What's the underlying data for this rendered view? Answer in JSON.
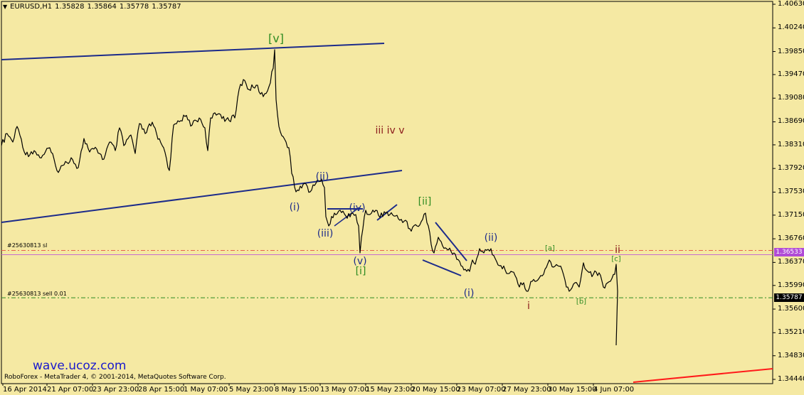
{
  "header": {
    "symbol": "EURUSD,H1",
    "open": "1.35828",
    "high": "1.35864",
    "low": "1.35778",
    "close": "1.35787"
  },
  "y_axis": {
    "ticks": [
      "1.40630",
      "1.40240",
      "1.39850",
      "1.39470",
      "1.39080",
      "1.38690",
      "1.38310",
      "1.37920",
      "1.37530",
      "1.37150",
      "1.36760",
      "1.36370",
      "1.35990",
      "1.35600",
      "1.35210",
      "1.34830",
      "1.34440"
    ],
    "price_tags": {
      "sl": "1.36533",
      "current": "1.35787"
    }
  },
  "x_axis": {
    "ticks": [
      "16 Apr 2014",
      "21 Apr 07:00",
      "23 Apr 23:00",
      "28 Apr 15:00",
      "1 May 07:00",
      "5 May 23:00",
      "8 May 15:00",
      "13 May 07:00",
      "15 May 23:00",
      "20 May 15:00",
      "23 May 07:00",
      "27 May 23:00",
      "30 May 15:00",
      "4 Jun 07:00"
    ]
  },
  "orders": {
    "sl_label": "#25630813 sl",
    "sell_label": "#25630813 sell 0.01"
  },
  "wave_labels": [
    {
      "text": "[v]",
      "color": "#2e8b22",
      "size": 16
    },
    {
      "text": "iii  iv v",
      "color": "#8b1a1a",
      "size": 14
    },
    {
      "text": "(ii)",
      "color": "#1c2b8a",
      "size": 14
    },
    {
      "text": "(i)",
      "color": "#1c2b8a",
      "size": 14
    },
    {
      "text": "(iii)",
      "color": "#1c2b8a",
      "size": 14
    },
    {
      "text": "(iv)",
      "color": "#1c2b8a",
      "size": 14
    },
    {
      "text": "(v)",
      "color": "#1c2b8a",
      "size": 14
    },
    {
      "text": "[i]",
      "color": "#2e8b22",
      "size": 14
    },
    {
      "text": "[ii]",
      "color": "#2e8b22",
      "size": 14
    },
    {
      "text": "(ii)",
      "color": "#1c2b8a",
      "size": 14
    },
    {
      "text": "(i)",
      "color": "#1c2b8a",
      "size": 14
    },
    {
      "text": "[a]",
      "color": "#2e8b22",
      "size": 10
    },
    {
      "text": "[b]",
      "color": "#2e8b22",
      "size": 10
    },
    {
      "text": "[c]",
      "color": "#2e8b22",
      "size": 10
    },
    {
      "text": "i",
      "color": "#8b1a1a",
      "size": 14
    },
    {
      "text": "ii",
      "color": "#8b1a1a",
      "size": 14
    }
  ],
  "watermark": "wave.ucoz.com",
  "footer": "RoboForex - MetaTrader 4, © 2001-2014, MetaQuotes Software Corp.",
  "colors": {
    "background": "#f5e9a3",
    "price_line": "#000000",
    "trend_line": "#1c2b8a",
    "stop_line": "#e8604a",
    "sell_line": "#2e8b22",
    "red_line": "#ff1a1a",
    "sl_tag": "#b04bd6",
    "current_tag": "#000000"
  }
}
